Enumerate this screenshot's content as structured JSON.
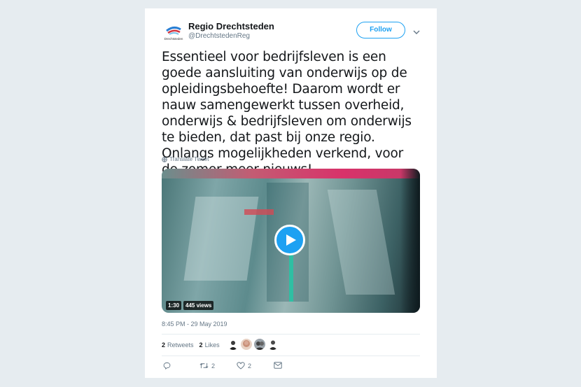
{
  "user": {
    "display_name": "Regio Drechtsteden",
    "handle": "@DrechtstedenReg",
    "avatar_text": "Drechtsteden"
  },
  "follow_label": "Follow",
  "tweet": {
    "text": "Essentieel voor bedrijfsleven is een goede aansluiting van onderwijs op de opleidingsbehoefte! Daarom wordt er nauw samengewerkt tussen overheid, onderwijs & bedrijfsleven om onderwijs te bieden, dat past bij onze regio. Onlangs mogelijkheden verkend, voor de zomer meer nieuws!",
    "translate_label": "Translate Tweet",
    "timestamp": "8:45 PM - 29 May 2019"
  },
  "video": {
    "duration": "1:30",
    "views": "445 views"
  },
  "stats": {
    "retweets_count": "2",
    "retweets_label": "Retweets",
    "likes_count": "2",
    "likes_label": "Likes"
  },
  "actions": {
    "retweet_count": "2",
    "like_count": "2"
  },
  "colors": {
    "accent": "#1da1f2",
    "text": "#14171a",
    "muted": "#657786",
    "background": "#e6ecf0"
  }
}
